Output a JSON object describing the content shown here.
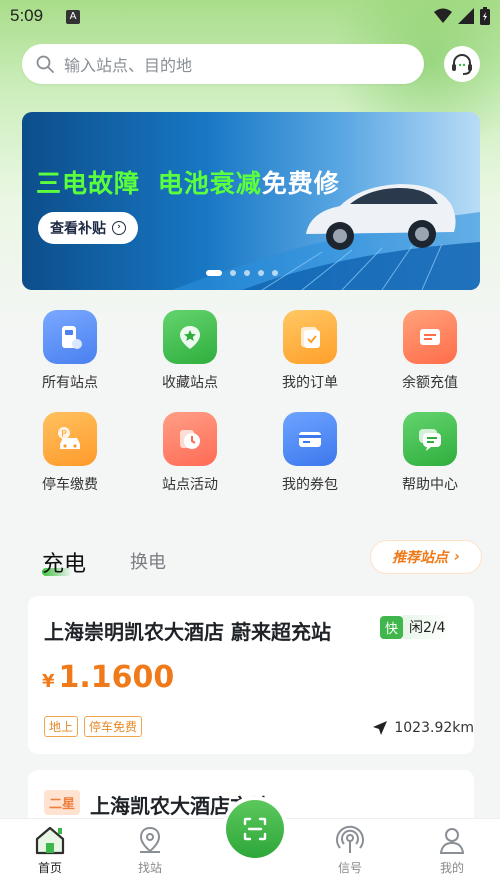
{
  "status_bar": {
    "time": "5:09",
    "notif_letter": "A"
  },
  "search": {
    "placeholder": "输入站点、目的地"
  },
  "banner": {
    "title_part1": "三电故障",
    "title_part2": "电池衰减",
    "title_part3": "免费修",
    "button_label": "查看补贴",
    "slides": 5,
    "active_slide": 0
  },
  "quick_grid": [
    {
      "label": "所有站点",
      "icon": "station-icon",
      "color": "#5b8ff5"
    },
    {
      "label": "收藏站点",
      "icon": "favorite-star-icon",
      "color": "#3cc04f"
    },
    {
      "label": "我的订单",
      "icon": "order-icon",
      "color": "#ffb13d"
    },
    {
      "label": "余额充值",
      "icon": "wallet-icon",
      "color": "#ff8a5c"
    },
    {
      "label": "停车缴费",
      "icon": "parking-car-icon",
      "color": "#ffa73a"
    },
    {
      "label": "站点活动",
      "icon": "activity-clock-icon",
      "color": "#ff7a5c"
    },
    {
      "label": "我的券包",
      "icon": "coupon-icon",
      "color": "#4a8cf5"
    },
    {
      "label": "帮助中心",
      "icon": "help-chat-icon",
      "color": "#3cc04f"
    }
  ],
  "tabs": {
    "charge": "充电",
    "swap": "换电"
  },
  "recommend_label": "推荐站点",
  "stations": [
    {
      "name": "上海崇明凯农大酒店 蔚来超充站",
      "fast_badge": "快",
      "availability": "闲2/4",
      "currency": "¥",
      "price": "1.1600",
      "tags": [
        "地上",
        "停车免费"
      ],
      "distance": "1023.92km"
    },
    {
      "badge": "二星",
      "name": "上海凯农大酒店充站"
    }
  ],
  "bottom_nav": [
    {
      "label": "首页",
      "icon": "home-icon",
      "active": true
    },
    {
      "label": "找站",
      "icon": "map-pin-icon",
      "active": false
    },
    {
      "label": "信号",
      "icon": "signal-icon",
      "active": false
    },
    {
      "label": "我的",
      "icon": "profile-icon",
      "active": false
    }
  ],
  "colors": {
    "accent": "#3cb84a",
    "price": "#f07a1a"
  }
}
